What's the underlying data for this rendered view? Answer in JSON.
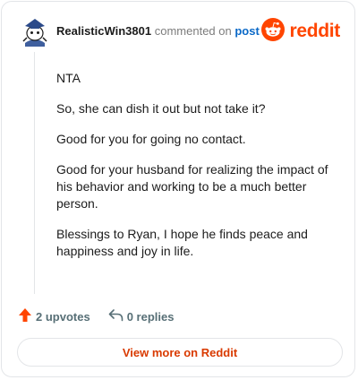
{
  "header": {
    "username": "RealisticWin3801",
    "action_text": "commented on",
    "post_link": "post",
    "brand": "reddit"
  },
  "comment": {
    "paragraphs": [
      "NTA",
      "So, she can dish it out but not take it?",
      "Good for you for going no contact.",
      "Good for your husband for realizing the impact of his behavior and working to be a much better person.",
      "Blessings to Ryan, I hope he finds peace and happiness and joy in life."
    ]
  },
  "actions": {
    "upvotes": "2 upvotes",
    "replies": "0 replies"
  },
  "footer": {
    "view_more": "View more on Reddit"
  },
  "colors": {
    "brand": "#ff4500",
    "link": "#0b69c7",
    "view_more": "#d93a00",
    "muted": "#576f76"
  },
  "icons": [
    "snoo-avatar-icon",
    "reddit-logo-icon",
    "upvote-arrow-icon",
    "reply-arrow-icon"
  ]
}
